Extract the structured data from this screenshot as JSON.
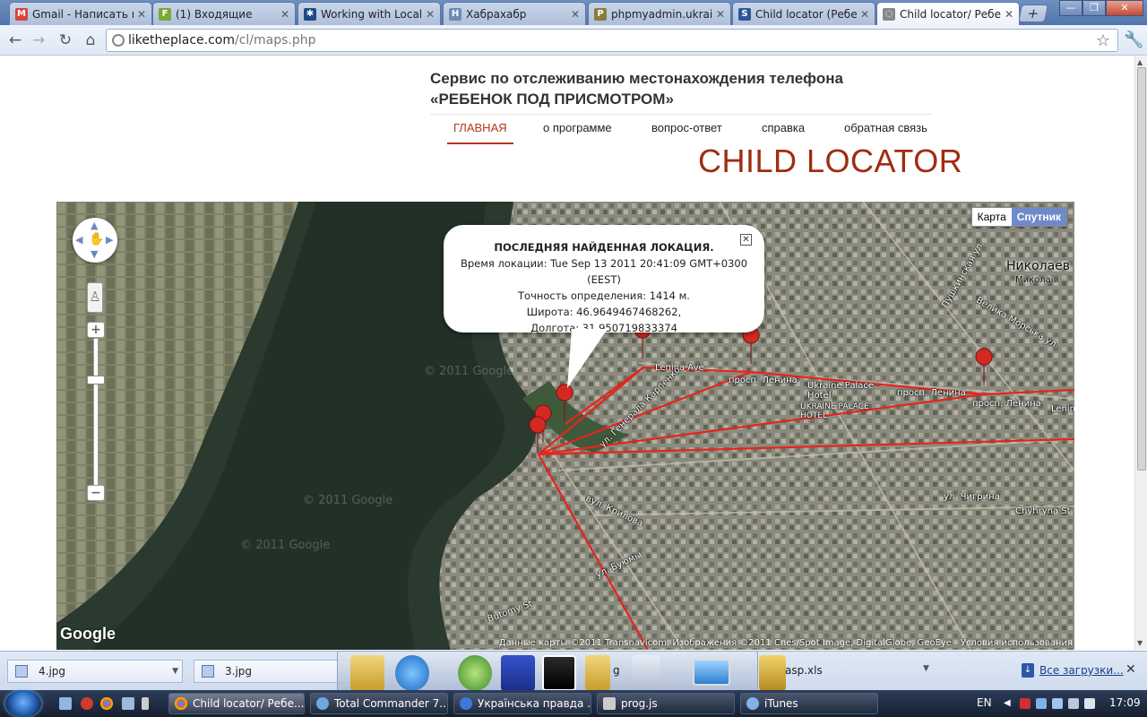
{
  "browser": {
    "tabs": [
      {
        "title": "Gmail - Написать пи",
        "icon_color": "#d44638",
        "icon_glyph": "M"
      },
      {
        "title": "(1) Входящие",
        "icon_color": "#7ba836",
        "icon_glyph": "F"
      },
      {
        "title": "Working with Local D",
        "icon_color": "#1f4a86",
        "icon_glyph": "✱"
      },
      {
        "title": "Хабрахабр",
        "icon_color": "#6b8cb5",
        "icon_glyph": "H"
      },
      {
        "title": "phpmyadmin.ukraine",
        "icon_color": "#8b7b3c",
        "icon_glyph": "P"
      },
      {
        "title": "Child locator (Ребен",
        "icon_color": "#2b5797",
        "icon_glyph": "S"
      },
      {
        "title": "Child locator/ Ребен",
        "icon_color": "#888888",
        "icon_glyph": "◌"
      }
    ],
    "active_tab": 6,
    "url_host": "liketheplace.com",
    "url_path": "/cl/maps.php"
  },
  "site": {
    "title_line1": "Сервис по отслеживанию местонахождения телефона",
    "title_line2": "«РЕБЕНОК ПОД ПРИСМОТРОМ»",
    "menu": [
      "ГЛАВНАЯ",
      "о программе",
      "вопрос-ответ",
      "справка",
      "обратная связь"
    ],
    "logo": "CHILD LOCATOR",
    "accent_color": "#a02c10"
  },
  "map": {
    "type_buttons": [
      "Карта",
      "Спутник"
    ],
    "selected_type": "Спутник",
    "infowindow": {
      "title": "ПОСЛЕДНЯЯ НАЙДЕННАЯ ЛОКАЦИЯ.",
      "time": "Время локации: Tue Sep 13 2011 20:41:09 GMT+0300 (EEST)",
      "accuracy": "Точность определения: 1414 м.",
      "latitude": "Широта: 46.9649467468262,",
      "longitude": "Долгота: 31.950719833374"
    },
    "labels": {
      "city": "Николаев",
      "city_sub": "Миколаїв",
      "lenina_ave": "Lenina Ave",
      "prosp_lenina_1": "просп. Ленина",
      "prosp_lenina_2": "просп. Ленина",
      "prosp_lenina_3": "просп. Ленина",
      "lenina_right": "Lenin",
      "hotel_en": "Ukraine Palace Hotel",
      "hotel_ru": "UKRAINE PALACE HOTEL",
      "chigrina": "ул. Чигрина",
      "spulhyna": "Chyhryna St",
      "pushkinskaya": "Пушкинская ул.",
      "velikaya": "Велика Морська ул.",
      "krylova": "вул. Крилова",
      "butomy": "Butomy St",
      "buyomy": "ул. Буюмы",
      "heneral": "ул. Генерала Карпенко"
    },
    "watermark": "© 2011 Google",
    "google_logo": "Google",
    "copyright": "Данные карты ©2011 Transnavicom, Изображения ©2011 Cnes/Spot Image, DigitalGlobe, GeoEye - Условия использования",
    "route_color": "#e8231d"
  },
  "downloads": {
    "items": [
      "4.jpg",
      "3.jpg"
    ],
    "partial_item": "asp.xls",
    "partial_prefix": "g",
    "all_label": "Все загрузки..."
  },
  "taskbar": {
    "buttons": [
      {
        "label": "Child locator/ Ребе...",
        "color": "#e9a23b"
      },
      {
        "label": "Total Commander 7....",
        "color": "#6fa8dc"
      },
      {
        "label": "Українська правда ...",
        "color": "#3c78d8"
      },
      {
        "label": "prog.js",
        "color": "#cccccc"
      },
      {
        "label": "iTunes",
        "color": "#7fb3e6"
      }
    ],
    "active_button": 0,
    "lang": "EN",
    "clock": "17:09"
  }
}
